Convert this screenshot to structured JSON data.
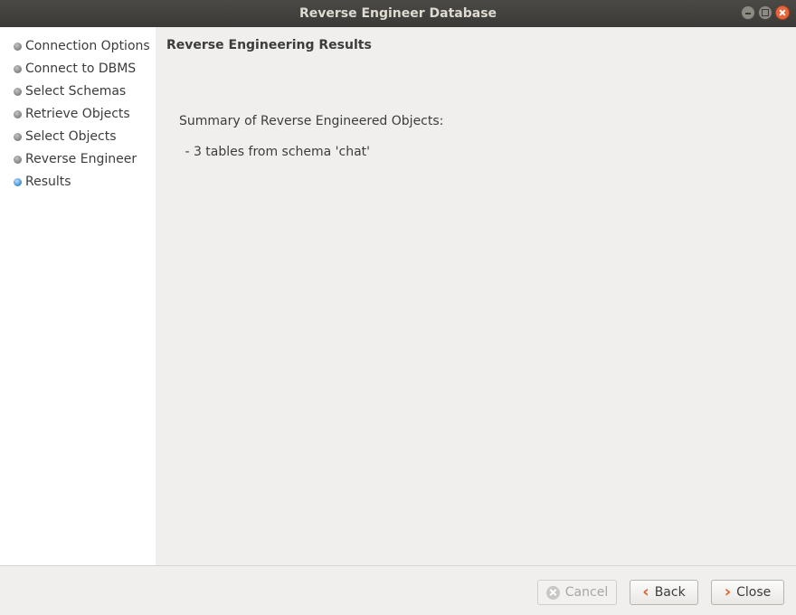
{
  "window": {
    "title": "Reverse Engineer Database"
  },
  "sidebar": {
    "steps": [
      {
        "label": "Connection Options",
        "state": "done"
      },
      {
        "label": "Connect to DBMS",
        "state": "done"
      },
      {
        "label": "Select Schemas",
        "state": "done"
      },
      {
        "label": "Retrieve Objects",
        "state": "done"
      },
      {
        "label": "Select Objects",
        "state": "done"
      },
      {
        "label": "Reverse Engineer",
        "state": "done"
      },
      {
        "label": "Results",
        "state": "active"
      }
    ]
  },
  "content": {
    "title": "Reverse Engineering Results",
    "summary_label": "Summary of Reverse Engineered Objects:",
    "summary_lines": [
      " - 3 tables from schema 'chat'"
    ]
  },
  "footer": {
    "cancel_label": "Cancel",
    "back_label": "Back",
    "close_label": "Close"
  },
  "colors": {
    "titlebar": "#3b3a37",
    "accent_chevron": "#e2622a",
    "active_step_bullet": "#4b97d8"
  }
}
